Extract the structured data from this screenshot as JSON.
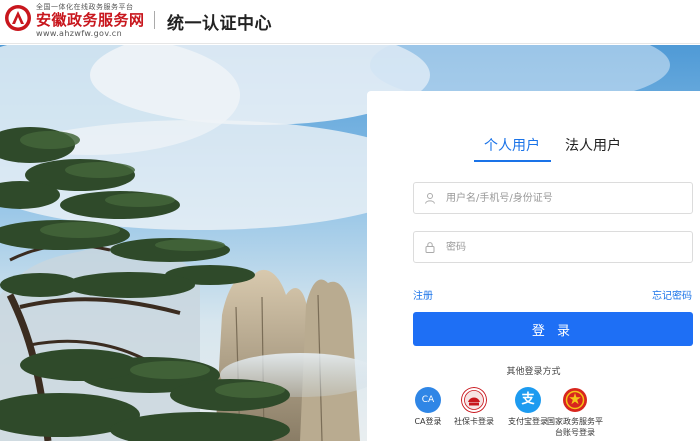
{
  "header": {
    "tagline": "全国一体化在线政务服务平台",
    "brand_name": "安徽政务服务网",
    "brand_url": "www.ahzwfw.gov.cn",
    "title": "统一认证中心"
  },
  "login": {
    "tabs": [
      "个人用户",
      "法人用户"
    ],
    "active_tab": "个人用户",
    "username_placeholder": "用户名/手机号/身份证号",
    "password_placeholder": "密码",
    "register_link": "注册",
    "forgot_link": "忘记密码",
    "login_button": "登 录",
    "other_methods_title": "其他登录方式",
    "methods": [
      {
        "label": "CA登录",
        "icon": "ca-icon",
        "badge": "CA"
      },
      {
        "label": "社保卡登录",
        "icon": "social-security-card-icon"
      },
      {
        "label": "支付宝登录",
        "icon": "alipay-icon",
        "badge": "支"
      },
      {
        "label": "国家政务服务平台账号登录",
        "icon": "national-emblem-icon"
      }
    ]
  },
  "colors": {
    "accent": "#1a73e8",
    "button": "#1e6ff5",
    "brand_red": "#c8161d"
  }
}
